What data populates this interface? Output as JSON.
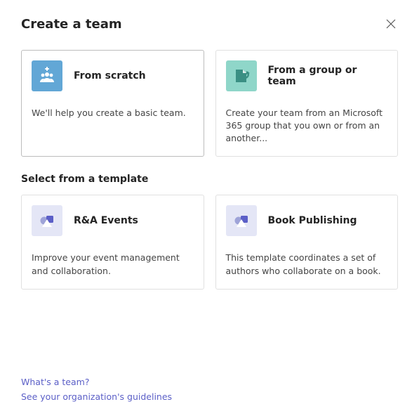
{
  "title": "Create a team",
  "top_cards": [
    {
      "title": "From scratch",
      "desc": "We'll help you create a basic team.",
      "icon": "people-plus-icon",
      "tile": "tile-scratch"
    },
    {
      "title": "From a group or team",
      "desc": "Create your team from an Microsoft 365 group that you own or from an another...",
      "icon": "copy-team-icon",
      "tile": "tile-group"
    }
  ],
  "template_section_label": "Select from a template",
  "template_cards": [
    {
      "title": "R&A Events",
      "desc": "Improve your event management and collaboration.",
      "icon": "template-icon",
      "tile": "tile-template"
    },
    {
      "title": "Book Publishing",
      "desc": "This template coordinates a set of authors who collaborate on a book.",
      "icon": "template-icon",
      "tile": "tile-template"
    }
  ],
  "footer_links": [
    "What's a team?",
    "See your organization's guidelines"
  ]
}
